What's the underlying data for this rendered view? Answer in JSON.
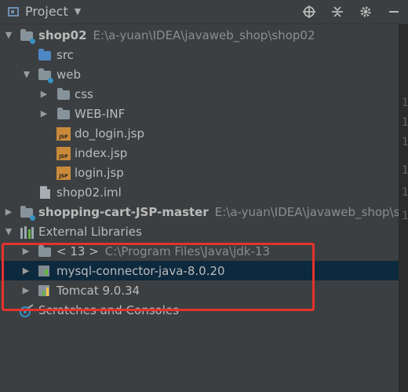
{
  "toolbar": {
    "title": "Project",
    "buttons": [
      "target-icon",
      "collapse-icon",
      "gear-icon",
      "minimize-icon"
    ]
  },
  "tree": {
    "shop02": {
      "name": "shop02",
      "path": "E:\\a-yuan\\IDEA\\javaweb_shop\\shop02"
    },
    "src": "src",
    "web": "web",
    "css": "css",
    "webinf": "WEB-INF",
    "do_login": "do_login.jsp",
    "index": "index.jsp",
    "login": "login.jsp",
    "iml": "shop02.iml",
    "shopping": {
      "name": "shopping-cart-JSP-master",
      "path": "E:\\a-yuan\\IDEA\\javaweb_shop\\shop"
    },
    "external": "External Libraries",
    "jdk": {
      "name": "< 13 >",
      "path": "C:\\Program Files\\Java\\jdk-13"
    },
    "mysql": "mysql-connector-java-8.0.20",
    "tomcat": "Tomcat 9.0.34",
    "scratches": "Scratches and Consoles"
  },
  "gutter_numbers": [
    "1",
    "1",
    "1",
    "1",
    "1",
    "1"
  ],
  "colors": {
    "highlight": "#e5322d",
    "selection": "#0d293e",
    "background": "#3c3f41"
  }
}
